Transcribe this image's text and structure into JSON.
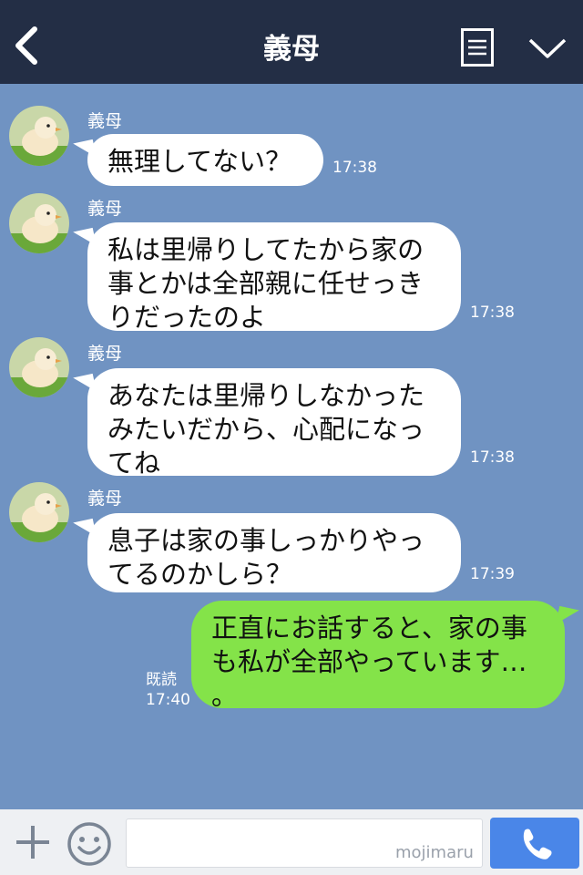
{
  "header": {
    "title": "義母"
  },
  "messages": [
    {
      "sender": "義母",
      "text": "無理してない？",
      "time": "17:38"
    },
    {
      "sender": "義母",
      "text": "私は里帰りしてたから家の\n事とかは全部親に任せっき\nりだったのよ",
      "time": "17:38"
    },
    {
      "sender": "義母",
      "text": "あなたは里帰りしなかった\nみたいだから、心配になっ\nてね",
      "time": "17:38"
    },
    {
      "sender": "義母",
      "text": "息子は家の事しっかりやっ\nてるのかしら？",
      "time": "17:39"
    }
  ],
  "reply": {
    "text": "正直にお話すると、家の事\nも私が全部やっています…\n。",
    "read_label": "既読",
    "time": "17:40"
  },
  "footer": {
    "watermark": "mojimaru",
    "input_value": ""
  },
  "colors": {
    "header_bg": "#232e45",
    "chat_bg": "#7093c2",
    "incoming_bubble": "#ffffff",
    "outgoing_bubble": "#84e349",
    "call_button": "#4a86e8"
  },
  "icons": [
    "back-arrow-icon",
    "menu-list-icon",
    "chevron-down-icon",
    "chick-avatar",
    "plus-icon",
    "smiley-icon",
    "phone-icon"
  ]
}
